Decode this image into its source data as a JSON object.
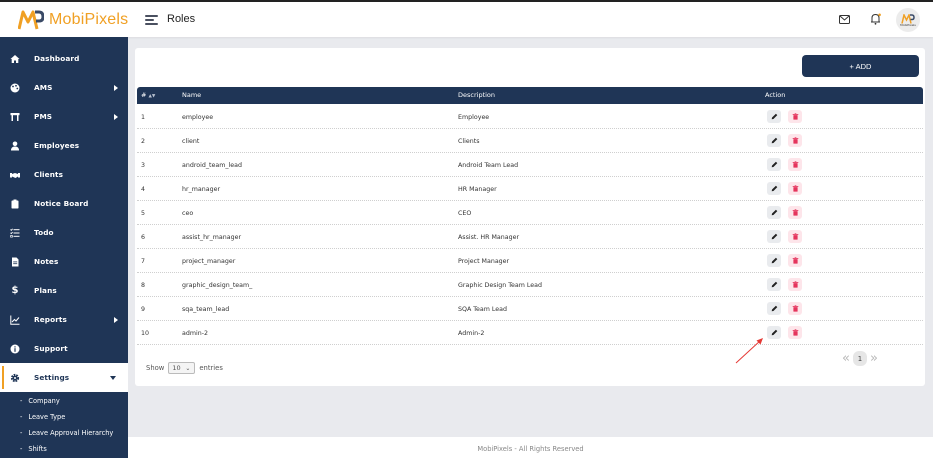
{
  "app": {
    "logo_text": "MobiPixels",
    "page_title": "Roles",
    "avatar_caption": "MobiPixels",
    "accent": "#f0a024",
    "brand": "#1f3556"
  },
  "sidebar": {
    "items": [
      {
        "label": "Dashboard",
        "icon": "home-icon",
        "has_caret": false
      },
      {
        "label": "AMS",
        "icon": "palette-icon",
        "has_caret": true
      },
      {
        "label": "PMS",
        "icon": "tools-icon",
        "has_caret": true
      },
      {
        "label": "Employees",
        "icon": "user-icon",
        "has_caret": false
      },
      {
        "label": "Clients",
        "icon": "handshake-icon",
        "has_caret": false
      },
      {
        "label": "Notice Board",
        "icon": "clipboard-icon",
        "has_caret": false
      },
      {
        "label": "Todo",
        "icon": "checklist-icon",
        "has_caret": false
      },
      {
        "label": "Notes",
        "icon": "note-icon",
        "has_caret": false
      },
      {
        "label": "Plans",
        "icon": "dollar-icon",
        "has_caret": false
      },
      {
        "label": "Reports",
        "icon": "chart-line-icon",
        "has_caret": true
      },
      {
        "label": "Support",
        "icon": "info-icon",
        "has_caret": false
      },
      {
        "label": "Settings",
        "icon": "gear-icon",
        "has_caret": true
      }
    ],
    "sub_items": [
      "Company",
      "Leave Type",
      "Leave Approval Hierarchy",
      "Shifts"
    ]
  },
  "toolbar": {
    "add_label": "+ ADD"
  },
  "table": {
    "columns": [
      "#",
      "Name",
      "Description",
      "Action"
    ],
    "rows": [
      {
        "num": "1",
        "name": "employee",
        "description": "Employee"
      },
      {
        "num": "2",
        "name": "client",
        "description": "Clients"
      },
      {
        "num": "3",
        "name": "android_team_lead",
        "description": "Android Team Lead"
      },
      {
        "num": "4",
        "name": "hr_manager",
        "description": "HR Manager"
      },
      {
        "num": "5",
        "name": "ceo",
        "description": "CEO"
      },
      {
        "num": "6",
        "name": "assist_hr_manager",
        "description": "Assist. HR Manager"
      },
      {
        "num": "7",
        "name": "project_manager",
        "description": "Project Manager"
      },
      {
        "num": "8",
        "name": "graphic_design_team_",
        "description": "Graphic Design Team Lead"
      },
      {
        "num": "9",
        "name": "sqa_team_lead",
        "description": "SQA Team Lead"
      },
      {
        "num": "10",
        "name": "admin-2",
        "description": "Admin-2"
      }
    ]
  },
  "pagination": {
    "show_label": "Show",
    "entries_value": "10",
    "entries_label": "entries",
    "first_label": "«",
    "current_page": "1",
    "last_label": "»"
  },
  "footer": {
    "text": "MobiPixels - All Rights Reserved"
  }
}
